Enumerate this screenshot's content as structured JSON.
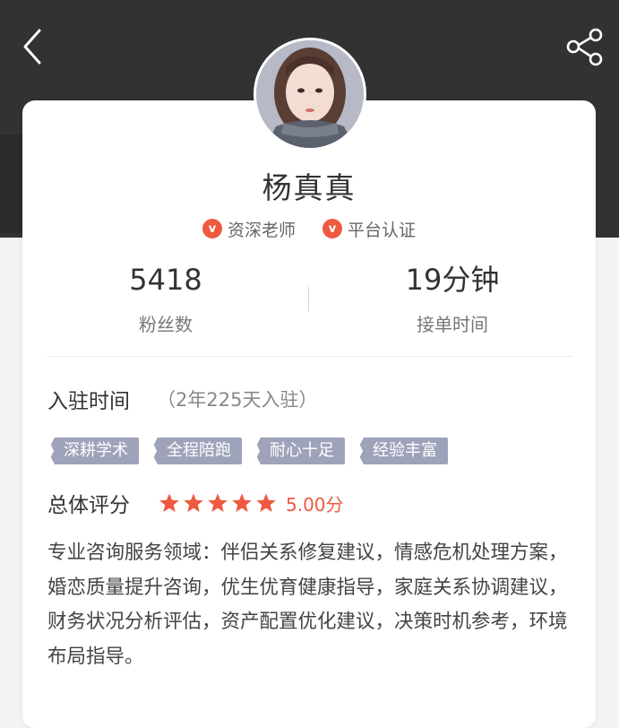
{
  "header": {
    "back_icon": "chevron-left-icon",
    "share_icon": "share-icon"
  },
  "profile": {
    "name": "杨真真",
    "badges": [
      {
        "icon": "v",
        "label": "资深老师"
      },
      {
        "icon": "v",
        "label": "平台认证"
      }
    ],
    "stats": [
      {
        "value": "5418",
        "label": "粉丝数"
      },
      {
        "value": "19分钟",
        "label": "接单时间"
      }
    ]
  },
  "details": {
    "join_title": "入驻时间",
    "join_duration": "（2年225天入驻）",
    "tags": [
      "深耕学术",
      "全程陪跑",
      "耐心十足",
      "经验丰富"
    ],
    "rating_title": "总体评分",
    "rating_stars": 5,
    "rating_score": "5.00分",
    "description": "专业咨询服务领域：伴侣关系修复建议，情感危机处理方案，婚恋质量提升咨询，优生优育健康指导，家庭关系协调建议，财务状况分析评估，资产配置优化建议，决策时机参考，环境布局指导。"
  },
  "colors": {
    "header_bg": "#323232",
    "accent": "#ee5a40",
    "tag_bg": "#9ea3ba"
  }
}
